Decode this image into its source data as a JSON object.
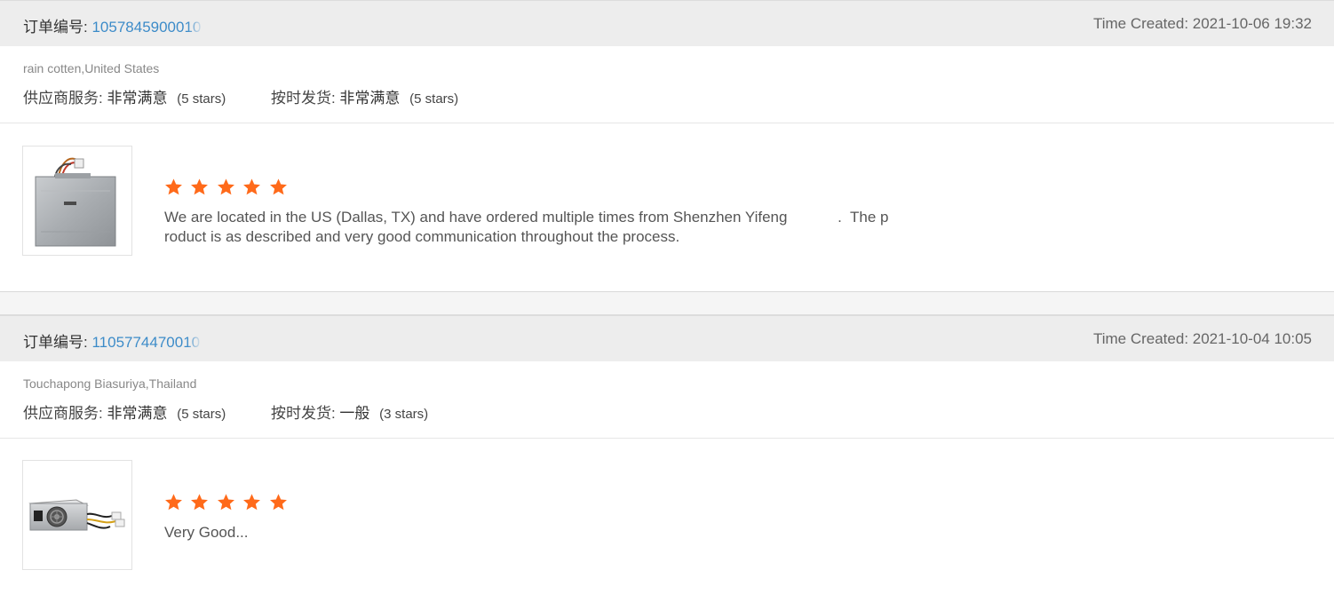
{
  "colors": {
    "header_bg": "#ededed",
    "order_number": "#3a8ac8",
    "star": "#ff6a1a",
    "text": "#333333",
    "muted": "#888888"
  },
  "reviews": [
    {
      "order_label": "订单编号:",
      "order_number": "1057845900010",
      "time_created": "Time Created: 2021-10-06 19:32",
      "buyer": "rain cotten,United States",
      "supplier_service_label": "供应商服务:",
      "supplier_service_value": "非常满意",
      "supplier_service_stars": "(5 stars)",
      "on_time_label": "按时发货:",
      "on_time_value": "非常满意",
      "on_time_stars": "(5 stars)",
      "rating": 5,
      "product_icon": "heatsink-plate-image",
      "comment_line1": "We are located in the US (Dallas, TX) and have ordered multiple times from Shenzhen Yifeng            .  The p",
      "comment_line2": "roduct is as described and very good communication throughout the process."
    },
    {
      "order_label": "订单编号:",
      "order_number": "1105774470010",
      "time_created": "Time Created: 2021-10-04 10:05",
      "buyer": "Touchapong Biasuriya,Thailand",
      "supplier_service_label": "供应商服务:",
      "supplier_service_value": "非常满意",
      "supplier_service_stars": "(5 stars)",
      "on_time_label": "按时发货:",
      "on_time_value": "一般",
      "on_time_stars": "(3 stars)",
      "rating": 5,
      "product_icon": "power-supply-image",
      "comment_line1": "Very Good...",
      "comment_line2": ""
    }
  ]
}
